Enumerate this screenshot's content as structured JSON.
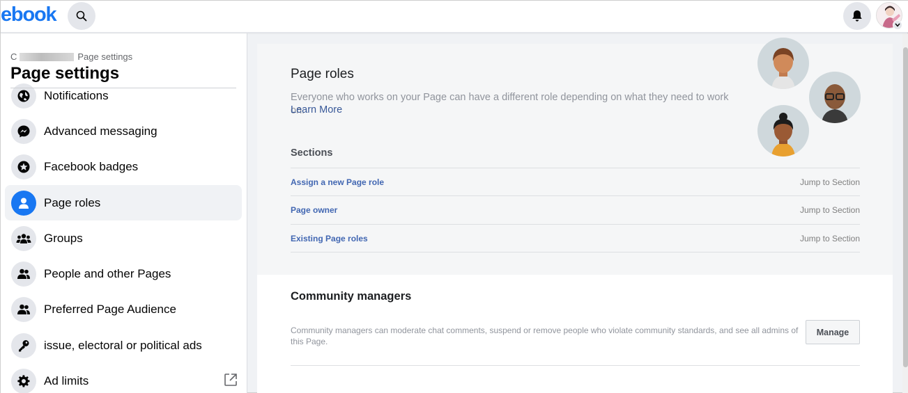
{
  "topbar": {
    "logo_text": "ebook",
    "search_icon": "search-icon",
    "bell_icon": "bell-icon"
  },
  "sidebar": {
    "breadcrumb_prefix": "C",
    "breadcrumb_current": "Page settings",
    "title": "Page settings",
    "items": [
      {
        "label": "Notifications",
        "icon": "globe-icon"
      },
      {
        "label": "Advanced messaging",
        "icon": "messenger-icon"
      },
      {
        "label": "Facebook badges",
        "icon": "badge-icon"
      },
      {
        "label": "Page roles",
        "icon": "person-icon",
        "active": true
      },
      {
        "label": "Groups",
        "icon": "groups-icon"
      },
      {
        "label": "People and other Pages",
        "icon": "people-icon"
      },
      {
        "label": "Preferred Page Audience",
        "icon": "people-icon"
      },
      {
        "label": "issue, electoral or political ads",
        "icon": "key-icon"
      },
      {
        "label": "Ad limits",
        "icon": "gear-icon"
      }
    ]
  },
  "page_roles": {
    "title": "Page roles",
    "description": "Everyone who works on your Page can have a different role depending on what they need to work on.",
    "learn_more": "Learn More",
    "sections_heading": "Sections",
    "sections": [
      {
        "label": "Assign a new Page role",
        "jump": "Jump to Section"
      },
      {
        "label": "Page owner",
        "jump": "Jump to Section"
      },
      {
        "label": "Existing Page roles",
        "jump": "Jump to Section"
      }
    ]
  },
  "community": {
    "title": "Community managers",
    "description": "Community managers can moderate chat comments, suspend or remove people who violate community standards, and see all admins of this Page.",
    "manage_label": "Manage"
  },
  "colors": {
    "brand": "#1877f2",
    "link": "#4267b2",
    "muted": "#90949c"
  }
}
